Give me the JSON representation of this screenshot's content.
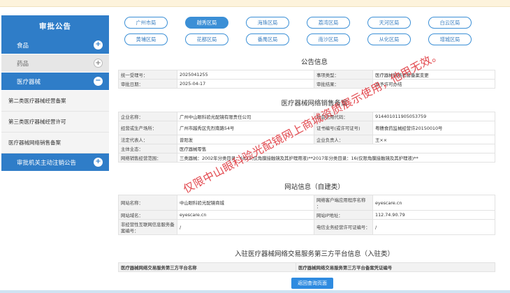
{
  "sidebar": {
    "title": "审批公告",
    "groups": [
      {
        "label": "食品",
        "toggle": "+"
      },
      {
        "label": "药品",
        "toggle": "+"
      },
      {
        "label": "医疗器械",
        "toggle": "−"
      }
    ],
    "subitems": [
      "第二类医疗器械经营备案",
      "第三类医疗器械经营许可",
      "医疗器械网络销售备案"
    ],
    "last_group": {
      "label": "审批机关主动注销公告",
      "toggle": "+"
    }
  },
  "regions": {
    "row1": [
      "广州市局",
      "越秀区局",
      "海珠区局",
      "荔湾区局",
      "天河区局",
      "白云区局"
    ],
    "row2": [
      "黄埔区局",
      "花都区局",
      "番禺区局",
      "南沙区局",
      "从化区局",
      "增城区局"
    ],
    "active": "越秀区局"
  },
  "notice": {
    "title": "公告信息",
    "unified_no_label": "统一受理号：",
    "unified_no": "2025041255",
    "type_label": "事项类型：",
    "type": "医疗器械网络销售备案变更",
    "date_label": "审批日期：",
    "date": "2025-04-17",
    "result_label": "审批结果：",
    "result": "准予许可办结"
  },
  "filing": {
    "title": "医疗器械网络销售备案",
    "company_label": "企业名称：",
    "company": "广州中山眼科验光配镜有限责任公司",
    "credit_label": "社会信用代码：",
    "credit": "914401011905053759",
    "address_label": "经营或生产场所：",
    "address": "广州市越秀区先烈南路54号",
    "cert_label": "证书编号(或许可证号)",
    "cert": "粤穗食药监械经营许20150010号",
    "legal_label": "法定代表人：",
    "legal": "曾阳发",
    "owner_label": "企业负责人：",
    "owner": "王××",
    "format_label": "主体业态：",
    "format": "医疗器械零售",
    "scope_label": "网络销售经营范围：",
    "scope": "三类器械：2002年分类目录：6822(仅角膜接触镜及其护理用液)**2017年分类目录：16(仅限角膜接触镜及其护理液)**"
  },
  "website": {
    "title": "网站信息（自建类）",
    "name_label": "网站名称：",
    "name": "中山眼科验光配镜商城",
    "app_label": "网络客户端应用程序名称",
    "app_colon": "：",
    "app": "eyescare.cn",
    "domain_label": "网站域名：",
    "domain": "eyescare.cn",
    "ip_label": "网站IP地址：",
    "ip": "112.74.90.79",
    "icp_label": "非经营性互联网信息服务备案编号：",
    "icp": "/",
    "telecom_label": "电信业务经营许可证编号：",
    "telecom": "/"
  },
  "platform": {
    "title": "入驻医疗器械网络交易服务第三方平台信息（入驻类）",
    "col1": "医疗器械网络交易服务第三方平台名称",
    "col2": "医疗器械网络交易服务第三方平台备案凭证编号"
  },
  "back_button": "返回查询页面",
  "watermark": "仅限中山眼科验光配镜网上商城资质展示使用，他用无效。"
}
